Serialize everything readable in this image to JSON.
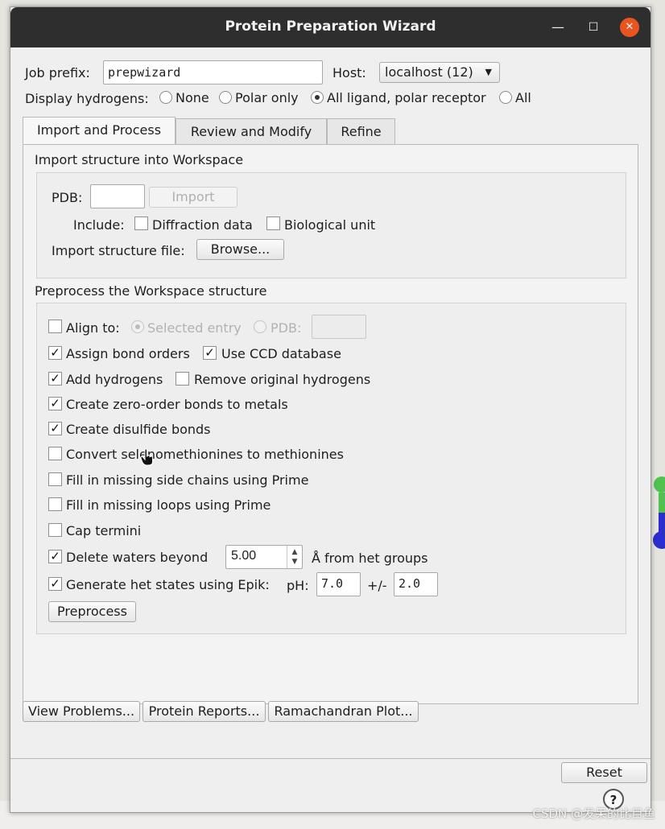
{
  "window": {
    "title": "Protein Preparation Wizard",
    "minimize": "—",
    "maximize": "☐",
    "close": "✕"
  },
  "job": {
    "prefix_label": "Job prefix:",
    "prefix_value": "prepwizard",
    "host_label": "Host:",
    "host_value": "localhost (12)"
  },
  "hydrogens": {
    "label": "Display hydrogens:",
    "options": [
      "None",
      "Polar only",
      "All ligand, polar receptor",
      "All"
    ],
    "selected": "All ligand, polar receptor"
  },
  "tabs": [
    "Import and Process",
    "Review and Modify",
    "Refine"
  ],
  "import": {
    "title": "Import structure into Workspace",
    "pdb_label": "PDB:",
    "import_button": "Import",
    "include_label": "Include:",
    "diffraction": "Diffraction data",
    "biounit": "Biological unit",
    "file_label": "Import structure file:",
    "browse_button": "Browse..."
  },
  "preprocess": {
    "title": "Preprocess the Workspace structure",
    "align_label": "Align to:",
    "selected_entry": "Selected entry",
    "pdb_label": "PDB:",
    "bond_orders": "Assign bond orders",
    "ccd": "Use CCD database",
    "add_h": "Add hydrogens",
    "remove_h": "Remove original hydrogens",
    "zero_order": "Create zero-order bonds to metals",
    "disulfide": "Create disulfide bonds",
    "selenomet": "Convert selenomethionines to methionines",
    "side_chains": "Fill in missing side chains using Prime",
    "loops": "Fill in missing loops using Prime",
    "cap": "Cap termini",
    "waters_label": "Delete waters beyond",
    "waters_value": "5.00",
    "waters_suffix": "Å from het groups",
    "epik_label": "Generate het states using Epik:",
    "ph_label": "pH:",
    "ph_value": "7.0",
    "pm_label": "+/-",
    "pm_value": "2.0",
    "button": "Preprocess",
    "check_mark": "✓"
  },
  "bottom": {
    "problems": "View Problems...",
    "reports": "Protein Reports...",
    "ramachandran": "Ramachandran Plot...",
    "reset": "Reset",
    "help": "?"
  },
  "watermark": "CSDN @发呆的比目鱼"
}
